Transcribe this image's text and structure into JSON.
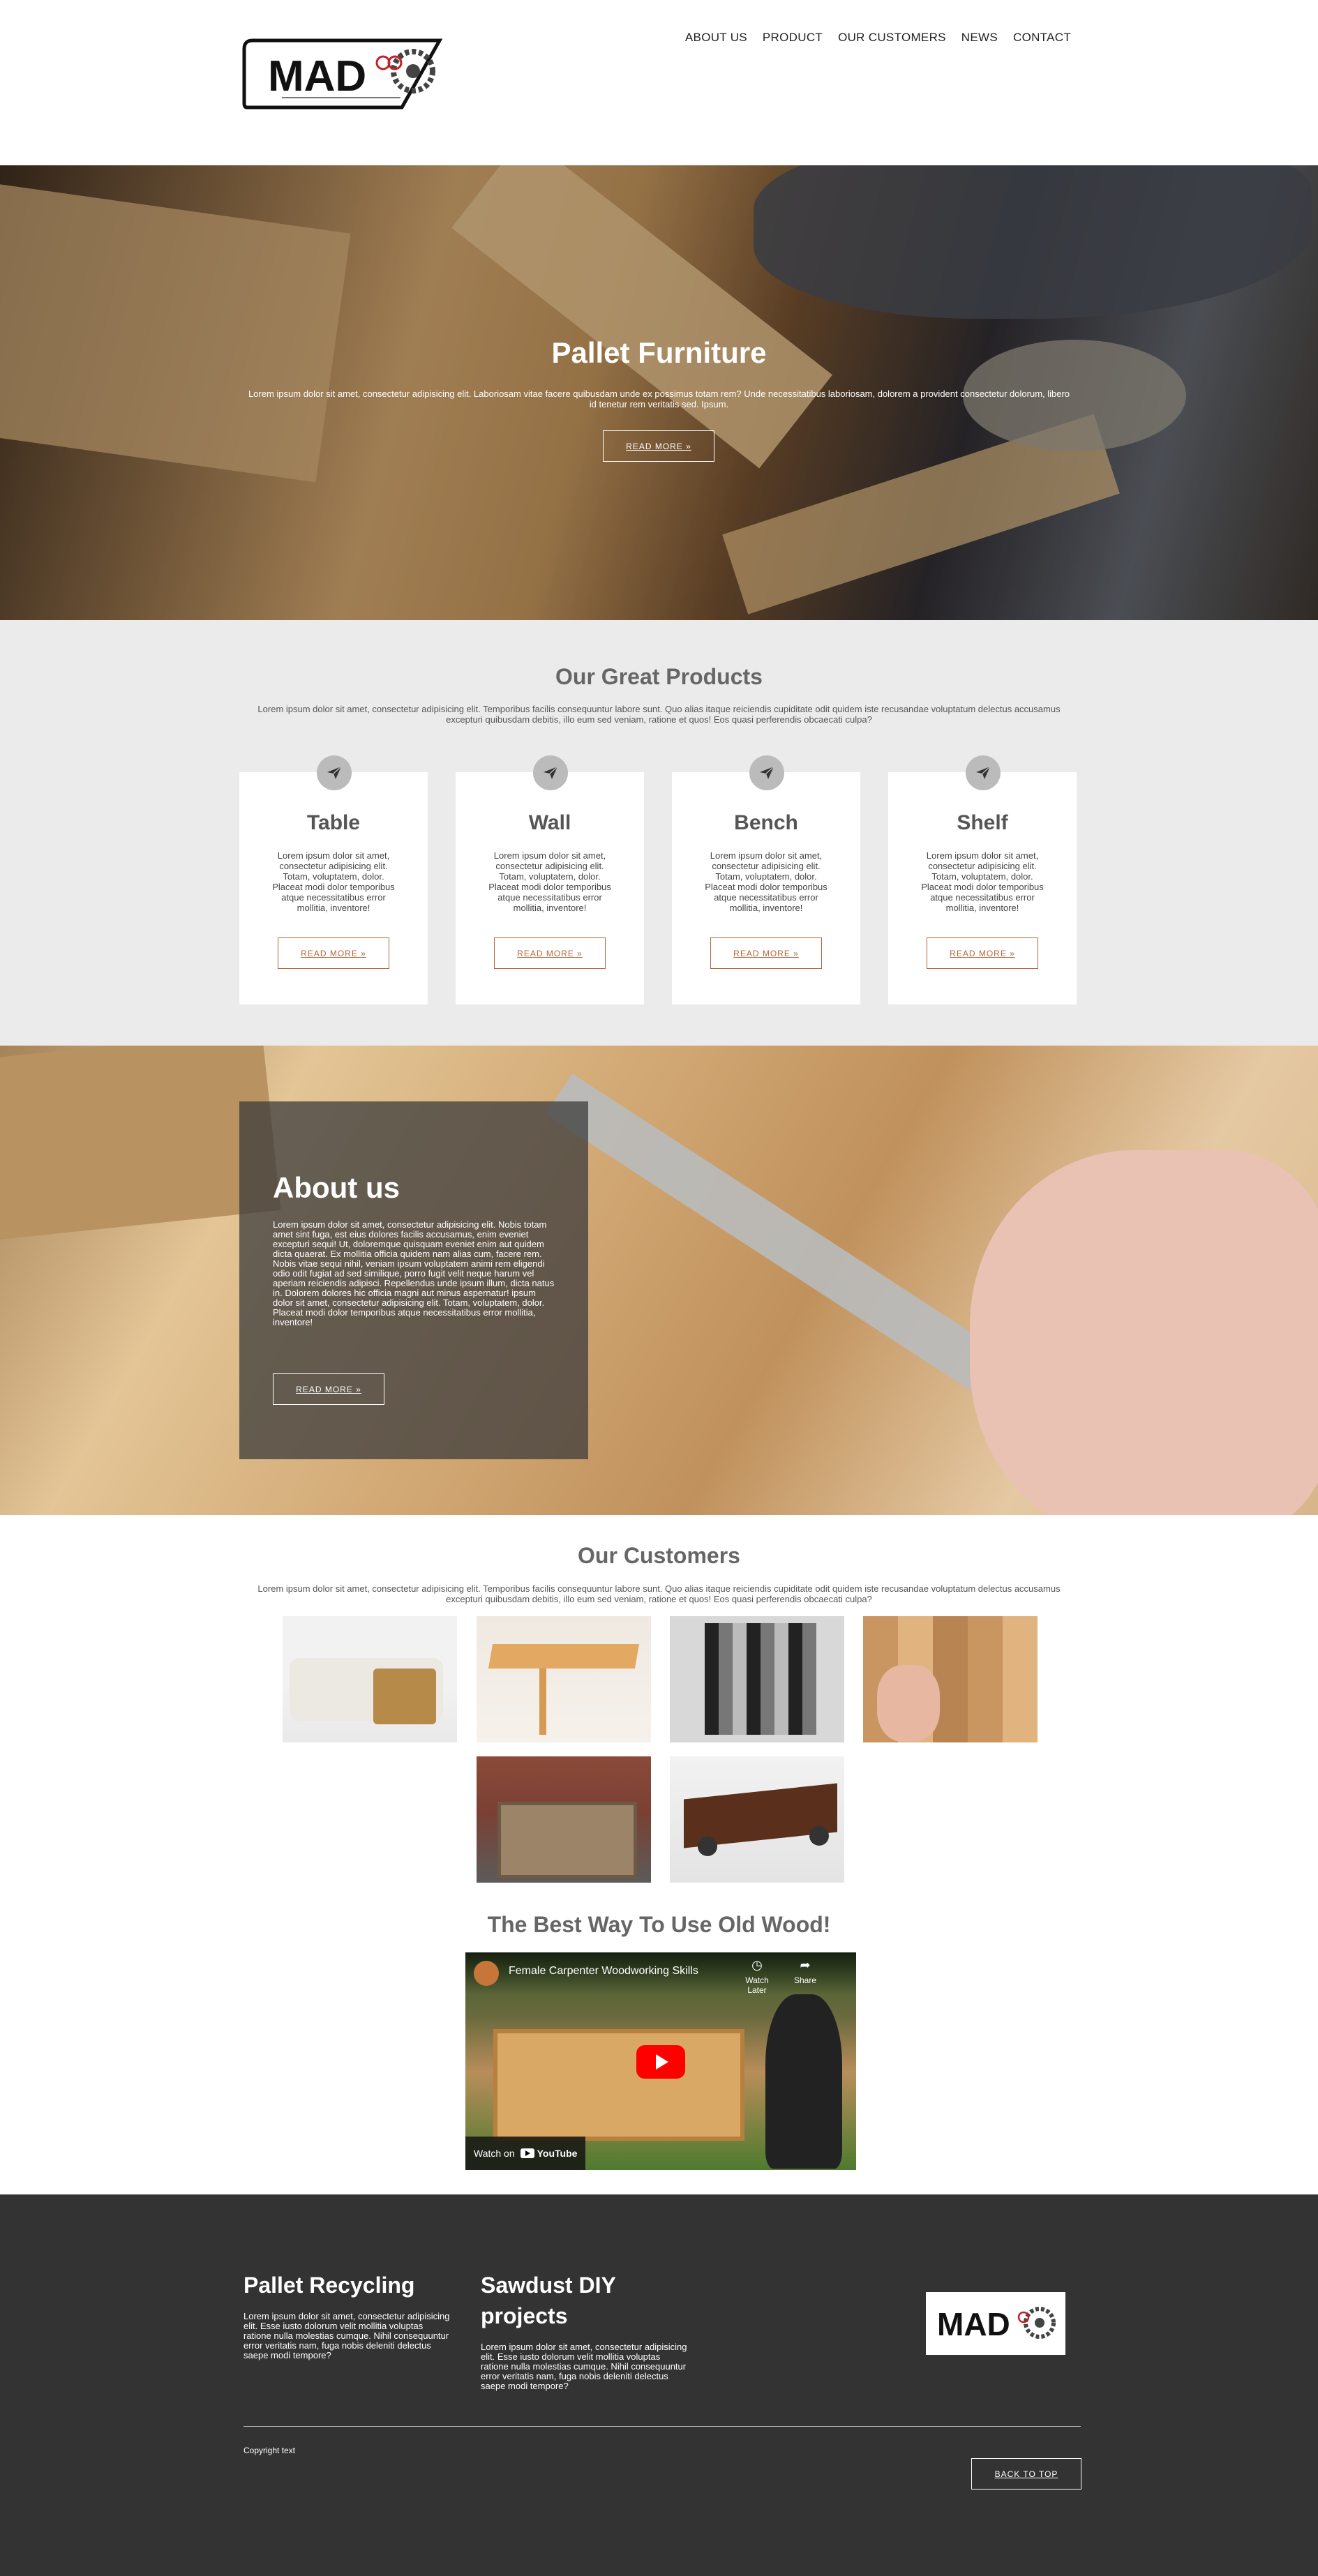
{
  "brand": {
    "logo_text": "MAD"
  },
  "nav": {
    "items": [
      "ABOUT US",
      "PRODUCT",
      "OUR CUSTOMERS",
      "NEWS",
      "CONTACT"
    ]
  },
  "hero": {
    "title": "Pallet Furniture",
    "text": "Lorem ipsum dolor sit amet, consectetur adipisicing elit. Laboriosam vitae facere quibusdam unde ex possimus totam rem? Unde necessitatibus laboriosam, dolorem a provident consectetur dolorum, libero id tenetur rem veritatis sed. Ipsum.",
    "button": "READ MORE »"
  },
  "products": {
    "title": "Our Great Products",
    "text": "Lorem ipsum dolor sit amet, consectetur adipisicing elit. Temporibus facilis consequuntur labore sunt. Quo alias itaque reiciendis cupiditate odit quidem iste recusandae voluptatum delectus accusamus excepturi quibusdam debitis, illo eum sed veniam, ratione et quos! Eos quasi perferendis obcaecati culpa?",
    "icon": "paper-plane-icon",
    "items": [
      {
        "name": "Table",
        "text": "Lorem ipsum dolor sit amet, consectetur adipisicing elit. Totam, voluptatem, dolor. Placeat modi dolor temporibus atque necessitatibus error mollitia, inventore!",
        "button": "READ MORE »"
      },
      {
        "name": "Wall",
        "text": "Lorem ipsum dolor sit amet, consectetur adipisicing elit. Totam, voluptatem, dolor. Placeat modi dolor temporibus atque necessitatibus error mollitia, inventore!",
        "button": "READ MORE »"
      },
      {
        "name": "Bench",
        "text": "Lorem ipsum dolor sit amet, consectetur adipisicing elit. Totam, voluptatem, dolor. Placeat modi dolor temporibus atque necessitatibus error mollitia, inventore!",
        "button": "READ MORE »"
      },
      {
        "name": "Shelf",
        "text": "Lorem ipsum dolor sit amet, consectetur adipisicing elit. Totam, voluptatem, dolor. Placeat modi dolor temporibus atque necessitatibus error mollitia, inventore!",
        "button": "READ MORE »"
      }
    ]
  },
  "about": {
    "title": "About us",
    "text": "Lorem ipsum dolor sit amet, consectetur adipisicing elit. Nobis totam amet sint fuga, est eius dolores facilis accusamus, enim eveniet excepturi sequi! Ut, doloremque quisquam eveniet enim aut quidem dicta quaerat. Ex mollitia officia quidem nam alias cum, facere rem. Nobis vitae sequi nihil, veniam ipsum voluptatem animi rem eligendi odio odit fugiat ad sed similique, porro fugit velit neque harum vel aperiam reiciendis adipisci. Repellendus unde ipsum illum, dicta natus in. Dolorem dolores hic officia magni aut minus aspernatur! ipsum dolor sit amet, consectetur adipisicing elit. Totam, voluptatem, dolor. Placeat modi dolor temporibus atque necessitatibus error mollitia, inventore!",
    "button": "READ MORE »"
  },
  "customers": {
    "title": "Our Customers",
    "text": "Lorem ipsum dolor sit amet, consectetur adipisicing elit. Temporibus facilis consequuntur labore sunt. Quo alias itaque reiciendis cupiditate odit quidem iste recusandae voluptatum delectus accusamus excepturi quibusdam debitis, illo eum sed veniam, ratione et quos! Eos quasi perferendis obcaecati culpa?"
  },
  "video_section": {
    "title": "The Best Way To Use Old Wood!",
    "video_title": "Female Carpenter Woodworking Skills",
    "watch_later": "Watch Later",
    "share": "Share",
    "watch_on": "Watch on",
    "youtube": "YouTube"
  },
  "footer": {
    "col1_title": "Pallet Recycling",
    "col1_text": "Lorem ipsum dolor sit amet, consectetur adipisicing elit. Esse iusto dolorum velit mollitia voluptas ratione nulla molestias cumque. Nihil consequuntur error veritatis nam, fuga nobis deleniti delectus saepe modi tempore?",
    "col2_title": "Sawdust DIY projects",
    "col2_text": "Lorem ipsum dolor sit amet, consectetur adipisicing elit. Esse iusto dolorum velit mollitia voluptas ratione nulla molestias cumque. Nihil consequuntur error veritatis nam, fuga nobis deleniti delectus saepe modi tempore?",
    "copyright": "Copyright text",
    "back_to_top": "BACK TO TOP"
  }
}
